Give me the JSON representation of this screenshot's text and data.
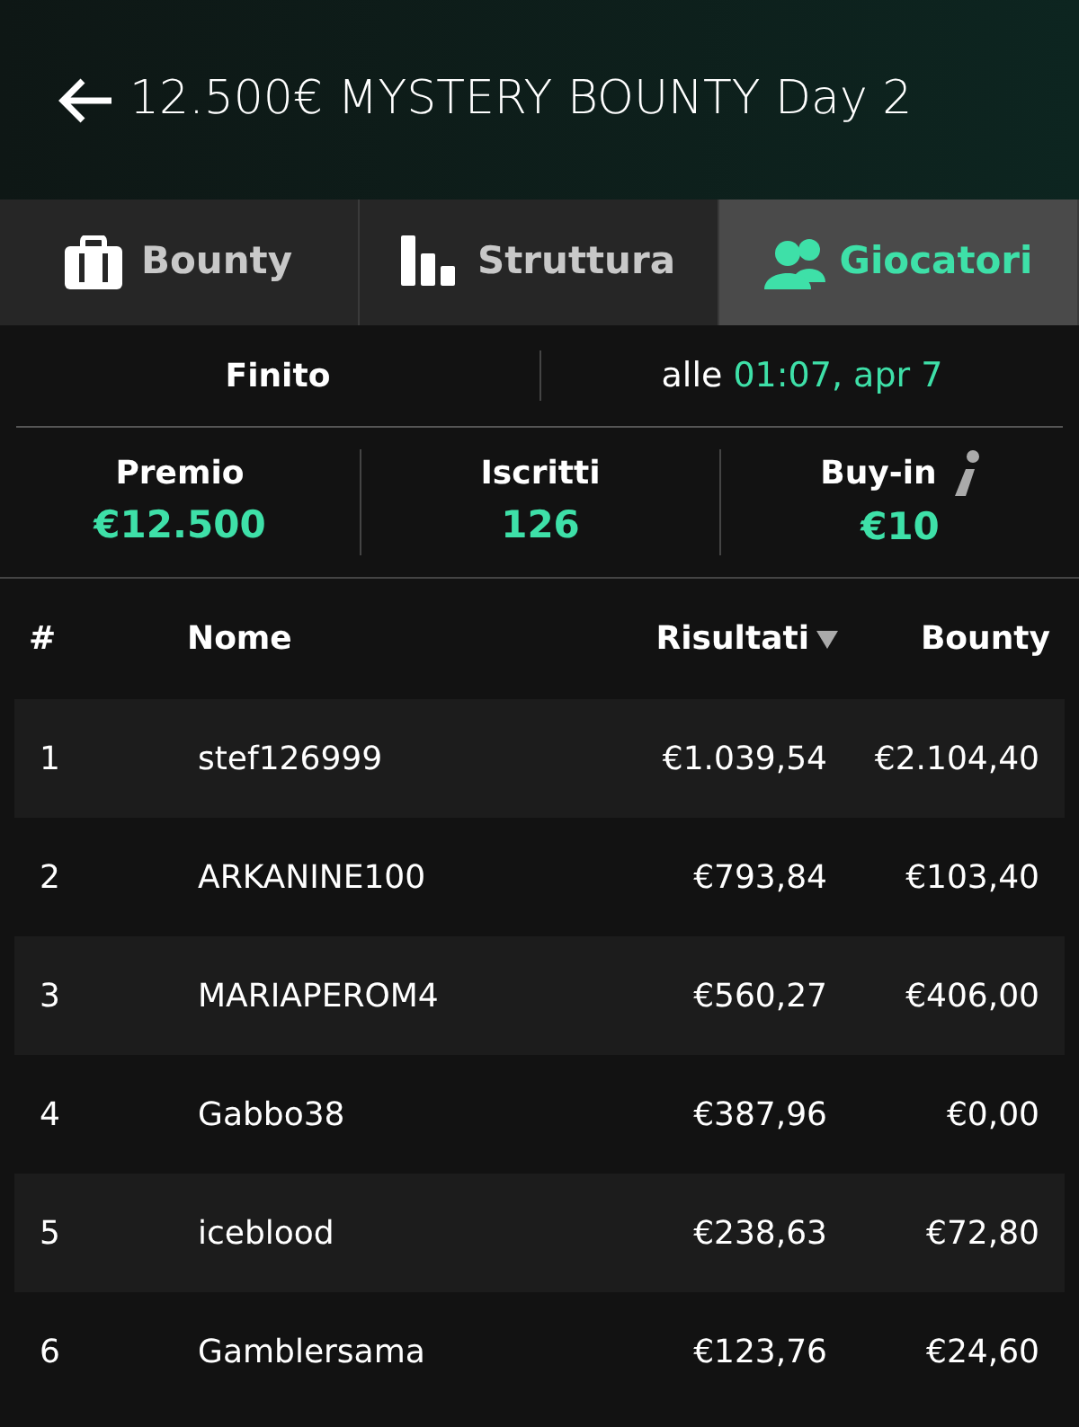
{
  "header": {
    "title": "12.500€ MYSTERY BOUNTY Day 2"
  },
  "tabs": [
    {
      "label": "Bounty",
      "selected": false
    },
    {
      "label": "Struttura",
      "selected": false
    },
    {
      "label": "Giocatori",
      "selected": true
    }
  ],
  "status": {
    "state": "Finito",
    "time_label": "alle",
    "time": "01:07, apr 7"
  },
  "stats": [
    {
      "label": "Premio",
      "value": "€12.500",
      "info": false
    },
    {
      "label": "Iscritti",
      "value": "126",
      "info": false
    },
    {
      "label": "Buy-in",
      "value": "€10",
      "info": true
    }
  ],
  "table": {
    "columns": [
      {
        "label": "#",
        "sorted": false
      },
      {
        "label": "Nome",
        "sorted": false
      },
      {
        "label": "Risultati",
        "sorted": true
      },
      {
        "label": "Bounty",
        "sorted": false
      }
    ],
    "rows": [
      [
        "1",
        "stef126999",
        "€1.039,54",
        "€2.104,40"
      ],
      [
        "2",
        "ARKANINE100",
        "€793,84",
        "€103,40"
      ],
      [
        "3",
        "MARIAPEROM4",
        "€560,27",
        "€406,00"
      ],
      [
        "4",
        "Gabbo38",
        "€387,96",
        "€0,00"
      ],
      [
        "5",
        "iceblood",
        "€238,63",
        "€72,80"
      ],
      [
        "6",
        "Gamblersama",
        "€123,76",
        "€24,60"
      ]
    ]
  }
}
